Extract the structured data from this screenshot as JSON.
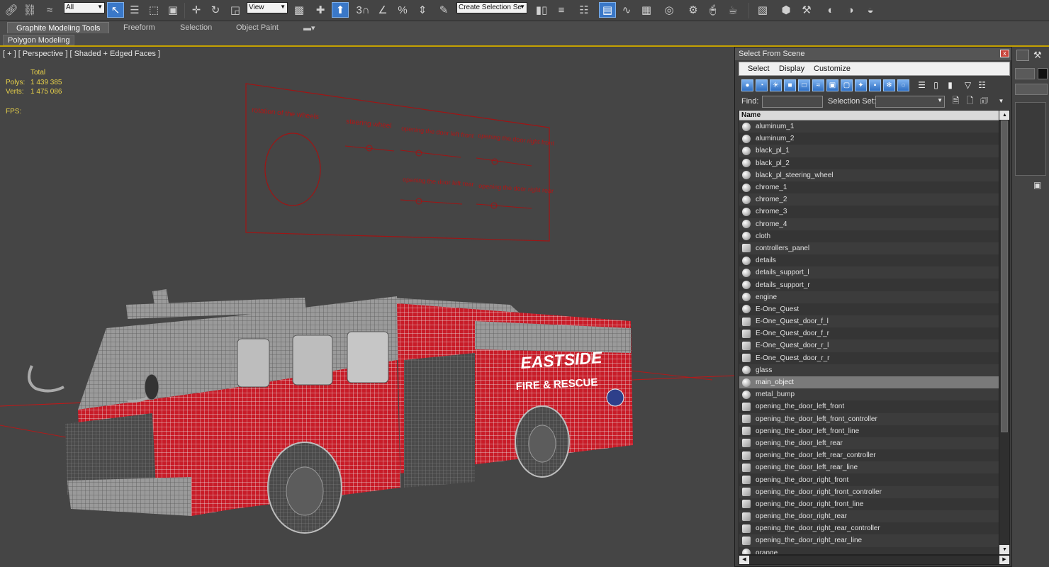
{
  "toolbar": {
    "selection_filter": "All",
    "reference_coord": "View",
    "named_selection": "Create Selection Se",
    "snap_label": "3"
  },
  "ribbon": {
    "tabs": [
      {
        "label": "Graphite Modeling Tools",
        "active": true
      },
      {
        "label": "Freeform",
        "active": false
      },
      {
        "label": "Selection",
        "active": false
      },
      {
        "label": "Object Paint",
        "active": false
      }
    ],
    "subtab": "Polygon Modeling"
  },
  "viewport": {
    "label": "[ + ] [ Perspective ] [ Shaded + Edged Faces ]",
    "stats": {
      "header": "Total",
      "polys_label": "Polys:",
      "polys_value": "1 439 385",
      "verts_label": "Verts:",
      "verts_value": "1 475 086",
      "fps_label": "FPS:"
    },
    "panel_labels": {
      "rotation": "rotation of the wheels",
      "steering": "steering wheel",
      "door_left_front": "opening the door left front",
      "door_right_front": "opening the door right front",
      "door_left_rear": "opening the door left rear",
      "door_right_rear": "opening the door right rear"
    },
    "truck_text": {
      "line1": "EASTSIDE",
      "line2": "FIRE & RESCUE"
    }
  },
  "dialog": {
    "title": "Select From Scene",
    "close": "x",
    "menu": [
      "Select",
      "Display",
      "Customize"
    ],
    "find_label": "Find:",
    "find_value": "",
    "selection_set_label": "Selection Set:",
    "selection_set_value": "",
    "column_name": "Name",
    "objects": [
      {
        "name": "aluminum_1",
        "group": false
      },
      {
        "name": "aluminum_2",
        "group": false
      },
      {
        "name": "black_pl_1",
        "group": false
      },
      {
        "name": "black_pl_2",
        "group": false
      },
      {
        "name": "black_pl_steering_wheel",
        "group": false
      },
      {
        "name": "chrome_1",
        "group": false
      },
      {
        "name": "chrome_2",
        "group": false
      },
      {
        "name": "chrome_3",
        "group": false
      },
      {
        "name": "chrome_4",
        "group": false
      },
      {
        "name": "cloth",
        "group": false
      },
      {
        "name": "controllers_panel",
        "group": true
      },
      {
        "name": "details",
        "group": false
      },
      {
        "name": "details_support_l",
        "group": false
      },
      {
        "name": "details_support_r",
        "group": false
      },
      {
        "name": "engine",
        "group": false
      },
      {
        "name": "E-One_Quest",
        "group": false
      },
      {
        "name": "E-One_Quest_door_f_l",
        "group": true
      },
      {
        "name": "E-One_Quest_door_f_r",
        "group": true
      },
      {
        "name": "E-One_Quest_door_r_l",
        "group": true
      },
      {
        "name": "E-One_Quest_door_r_r",
        "group": true
      },
      {
        "name": "glass",
        "group": false
      },
      {
        "name": "main_object",
        "group": false,
        "selected": true
      },
      {
        "name": "metal_bump",
        "group": false
      },
      {
        "name": "opening_the_door_left_front",
        "group": true
      },
      {
        "name": "opening_the_door_left_front_controller",
        "group": true
      },
      {
        "name": "opening_the_door_left_front_line",
        "group": true
      },
      {
        "name": "opening_the_door_left_rear",
        "group": true
      },
      {
        "name": "opening_the_door_left_rear_controller",
        "group": true
      },
      {
        "name": "opening_the_door_left_rear_line",
        "group": true
      },
      {
        "name": "opening_the_door_right_front",
        "group": true
      },
      {
        "name": "opening_the_door_right_front_controller",
        "group": true
      },
      {
        "name": "opening_the_door_right_front_line",
        "group": true
      },
      {
        "name": "opening_the_door_right_rear",
        "group": true
      },
      {
        "name": "opening_the_door_right_rear_controller",
        "group": true
      },
      {
        "name": "opening_the_door_right_rear_line",
        "group": true
      },
      {
        "name": "orange",
        "group": false
      }
    ]
  },
  "colors": {
    "accent": "#3a78c8",
    "stats": "#e8d14a",
    "wire_red": "#c01818",
    "ribbon_line": "#c5a100"
  }
}
